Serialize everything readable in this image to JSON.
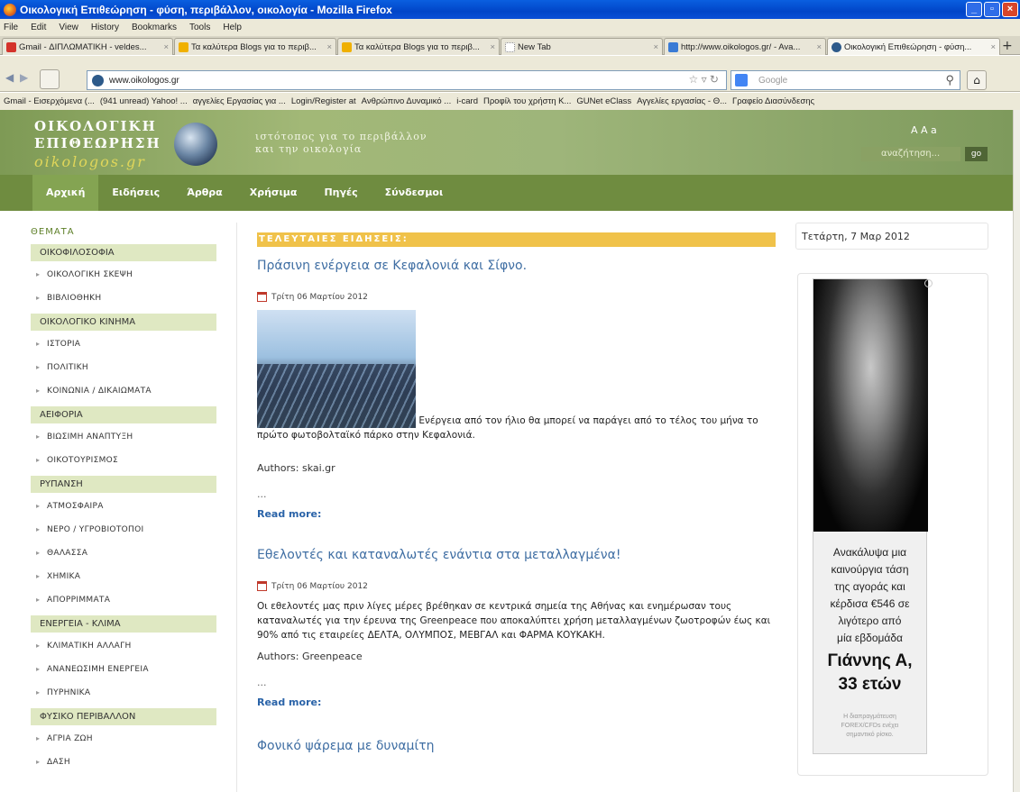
{
  "window": {
    "title": "Οικολογική Επιθεώρηση - φύση, περιβάλλον, οικολογία - Mozilla Firefox",
    "min": "_",
    "max": "▫",
    "close": "×"
  },
  "menu": [
    "File",
    "Edit",
    "View",
    "History",
    "Bookmarks",
    "Tools",
    "Help"
  ],
  "tabs": [
    {
      "label": "Gmail - ΔΙΠΛΩΜΑΤΙΚΗ - veldes...",
      "icon_color": "#d4332b"
    },
    {
      "label": "Τα καλύτερα Blogs για το περιβ...",
      "icon_color": "#f0b000"
    },
    {
      "label": "Τα καλύτερα Blogs για το περιβ...",
      "icon_color": "#f0b000"
    },
    {
      "label": "New Tab",
      "icon_color": "#ffffff"
    },
    {
      "label": "http://www.oikologos.gr/ - Ava...",
      "icon_color": "#3a7bd5"
    },
    {
      "label": "Οικολογική Επιθεώρηση - φύση...",
      "icon_color": "#2d5a8a"
    }
  ],
  "tab_close": "×",
  "new_tab": "+",
  "address": {
    "url": "www.oikologos.gr",
    "search_placeholder": "Google"
  },
  "bookmarks": [
    "Gmail - Εισερχόμενα (...",
    "(941 unread) Yahoo! ...",
    "αγγελίες Εργασίας για ...",
    "Login/Register at",
    "Ανθρώπινο Δυναμικό ...",
    "i-card",
    "Προφίλ του χρήστη Κ...",
    "GUNet eClass",
    "Αγγελίες εργασίας - Θ...",
    "Γραφείο Διασύνδεσης"
  ],
  "site": {
    "logo_line1": "ΟΙΚΟΛΟΓΙΚΗ",
    "logo_line2": "ΕΠΙΘΕΩΡΗΣΗ",
    "logo_line3": "oikologos.gr",
    "tagline1": "ιστότοπος για το περιβάλλον",
    "tagline2": "και την οικολογία",
    "font_sizes": "A  A  a",
    "search_placeholder": "αναζήτηση...",
    "go": "go",
    "nav": [
      "Αρχική",
      "Ειδήσεις",
      "Άρθρα",
      "Χρήσιμα",
      "Πηγές",
      "Σύνδεσμοι"
    ]
  },
  "sidebar": {
    "title": "ΘΕΜΑΤΑ",
    "groups": [
      {
        "label": "ΟΙΚΟΦΙΛΟΣΟΦΙΑ",
        "items": [
          "ΟΙΚΟΛΟΓΙΚΗ ΣΚΕΨΗ",
          "ΒΙΒΛΙΟΘΗΚΗ"
        ]
      },
      {
        "label": "ΟΙΚΟΛΟΓΙΚΟ ΚΙΝΗΜΑ",
        "items": [
          "ΙΣΤΟΡΙΑ",
          "ΠΟΛΙΤΙΚΗ",
          "ΚΟΙΝΩΝΙΑ / ΔΙΚΑΙΩΜΑΤΑ"
        ]
      },
      {
        "label": "ΑΕΙΦΟΡΙΑ",
        "items": [
          "ΒΙΩΣΙΜΗ ΑΝΑΠΤΥΞΗ",
          "ΟΙΚΟΤΟΥΡΙΣΜΟΣ"
        ]
      },
      {
        "label": "ΡΥΠΑΝΣΗ",
        "items": [
          "ΑΤΜΟΣΦΑΙΡΑ",
          "ΝΕΡΟ / ΥΓΡΟΒΙΟΤΟΠΟΙ",
          "ΘΑΛΑΣΣΑ",
          "ΧΗΜΙΚΑ",
          "ΑΠΟΡΡΙΜΜΑΤΑ"
        ]
      },
      {
        "label": "ΕΝΕΡΓΕΙΑ - ΚΛΙΜΑ",
        "items": [
          "ΚΛΙΜΑΤΙΚΗ ΑΛΛΑΓΗ",
          "ΑΝΑΝΕΩΣΙΜΗ ΕΝΕΡΓΕΙΑ",
          "ΠΥΡΗΝΙΚΑ"
        ]
      },
      {
        "label": "ΦΥΣΙΚΟ ΠΕΡΙΒΑΛΛΟΝ",
        "items": [
          "ΑΓΡΙΑ ΖΩΗ",
          "ΔΑΣΗ"
        ]
      }
    ]
  },
  "main": {
    "section_title": "ΤΕΛΕΥΤΑΙΕΣ ΕΙΔΗΣΕΙΣ:",
    "articles": [
      {
        "title": "Πράσινη ενέργεια σε Κεφαλονιά και Σίφνο.",
        "date": "Τρίτη 06 Μαρτίου 2012",
        "text": "Ενέργεια από τον ήλιο θα μπορεί να παράγει από το τέλος του μήνα το πρώτο φωτοβολταϊκό πάρκο στην Κεφαλονιά.",
        "authors": "Authors: skai.gr",
        "ellipsis": "...",
        "read_more": "Read more:"
      },
      {
        "title": "Εθελοντές και καταναλωτές ενάντια στα μεταλλαγμένα!",
        "date": "Τρίτη 06 Μαρτίου 2012",
        "text": "Οι εθελοντές μας πριν λίγες μέρες βρέθηκαν σε κεντρικά σημεία της Αθήνας και ενημέρωσαν τους καταναλωτές για την έρευνα της Greenpeace που αποκαλύπτει χρήση μεταλλαγμένων ζωοτροφών έως και 90% από τις εταιρείες ΔΕΛΤΑ, ΟΛΥΜΠΟΣ, ΜΕΒΓΑΛ και ΦΑΡΜΑ ΚΟΥΚΑΚΗ.",
        "authors": "Authors: Greenpeace",
        "ellipsis": "...",
        "read_more": "Read more:"
      },
      {
        "title": "Φονικό ψάρεμα με δυναμίτη"
      }
    ]
  },
  "right": {
    "date": "Τετάρτη, 7 Μαρ 2012",
    "ad": {
      "line1": "Ανακάλυψα μια",
      "line2": "καινούργια τάση",
      "line3": "της αγοράς και",
      "line4": "κέρδισα €546 σε",
      "line5": "λιγότερο από",
      "line6": "μία εβδομάδα",
      "name1": "Γιάννης Α,",
      "name2": "33 ετών",
      "risk1": "Η διαπραγμάτευση",
      "risk2": "FOREX/CFDs ενέχει",
      "risk3": "σημαντικό ρίσκο.",
      "info": "i"
    }
  }
}
